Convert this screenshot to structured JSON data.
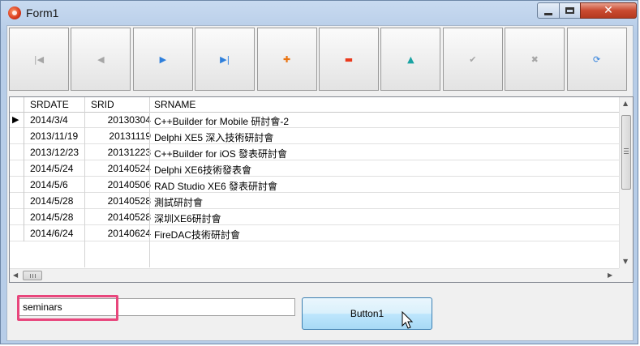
{
  "window": {
    "title": "Form1"
  },
  "navigator": {
    "buttons": [
      {
        "name": "first-record",
        "glyph": "|◀",
        "color": "#a6a6a6"
      },
      {
        "name": "prior-record",
        "glyph": "◀",
        "color": "#a6a6a6"
      },
      {
        "name": "next-record",
        "glyph": "▶",
        "color": "#2e7fdc"
      },
      {
        "name": "last-record",
        "glyph": "▶|",
        "color": "#2e7fdc"
      },
      {
        "name": "insert-record",
        "glyph": "✚",
        "color": "#ea7411"
      },
      {
        "name": "delete-record",
        "glyph": "▬",
        "color": "#ea3a1d"
      },
      {
        "name": "edit-record",
        "glyph": "▲",
        "color": "#1aa3a3"
      },
      {
        "name": "post-edit",
        "glyph": "✔",
        "color": "#a6a6a6"
      },
      {
        "name": "cancel-edit",
        "glyph": "✖",
        "color": "#a6a6a6"
      },
      {
        "name": "refresh-data",
        "glyph": "⟳",
        "color": "#2e7fdc"
      }
    ]
  },
  "grid": {
    "columns": [
      "SRDATE",
      "SRID",
      "SRNAME"
    ],
    "rows": [
      {
        "date": "2014/3/4",
        "id": "20130304",
        "name": "C++Builder for Mobile 研討會-2",
        "current": true
      },
      {
        "date": "2013/11/19",
        "id": "20131119",
        "name": "Delphi XE5 深入技術研討會"
      },
      {
        "date": "2013/12/23",
        "id": "20131223",
        "name": "C++Builder for iOS 發表研討會"
      },
      {
        "date": "2014/5/24",
        "id": "20140524",
        "name": "Delphi XE6技術發表會"
      },
      {
        "date": "2014/5/6",
        "id": "20140506",
        "name": "RAD Studio XE6 發表研討會"
      },
      {
        "date": "2014/5/28",
        "id": "20140528",
        "name": "測試研討會"
      },
      {
        "date": "2014/5/28",
        "id": "20140528",
        "name": "深圳XE6研討會"
      },
      {
        "date": "2014/6/24",
        "id": "20140624",
        "name": "FireDAC技術研討會"
      }
    ]
  },
  "edit1": {
    "value": "seminars"
  },
  "button1": {
    "label": "Button1"
  },
  "colors": {
    "highlight": "#e8467c"
  }
}
